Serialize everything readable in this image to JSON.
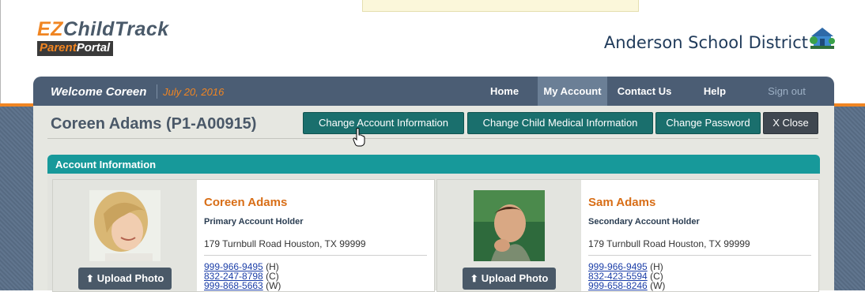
{
  "brand": {
    "logo_ez": "EZ",
    "logo_rest": "ChildTrack",
    "portal_parent": "Parent",
    "portal_rest": "Portal",
    "district": "Anderson School District",
    "accent": "#f08522",
    "nav_color": "#4b5d74",
    "teal": "#17999a",
    "button_teal": "#1a6f6d"
  },
  "nav": {
    "welcome": "Welcome Coreen",
    "date": "July 20, 2016",
    "items": [
      {
        "label": "Home"
      },
      {
        "label": "My Account",
        "active": true
      },
      {
        "label": "Contact Us"
      },
      {
        "label": "Help"
      },
      {
        "label": "Sign out"
      }
    ]
  },
  "page": {
    "title": "Coreen Adams (P1-A00915)",
    "buttons": {
      "change_account": "Change Account Information",
      "change_medical": "Change Child Medical Information",
      "change_password": "Change Password",
      "close": "X Close"
    }
  },
  "section": {
    "title": "Account Information"
  },
  "holders": [
    {
      "name": "Coreen Adams",
      "role": "Primary Account Holder",
      "address": "179 Turnbull Road Houston, TX 99999",
      "upload_label": "Upload Photo",
      "phones": [
        {
          "number": "999-966-9495",
          "type": "(H)"
        },
        {
          "number": "832-247-8798",
          "type": "(C)"
        },
        {
          "number": "999-868-5663",
          "type": "(W)"
        }
      ]
    },
    {
      "name": "Sam Adams",
      "role": "Secondary Account Holder",
      "address": "179 Turnbull Road Houston, TX 99999",
      "upload_label": "Upload Photo",
      "phones": [
        {
          "number": "999-966-9495",
          "type": "(H)"
        },
        {
          "number": "832-423-5594",
          "type": "(C)"
        },
        {
          "number": "999-658-8246",
          "type": "(W)"
        }
      ]
    }
  ]
}
